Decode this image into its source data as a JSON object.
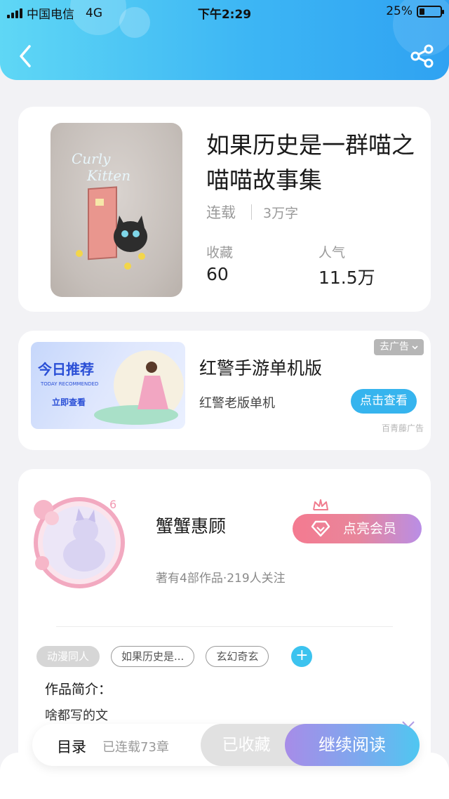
{
  "status_bar": {
    "carrier": "中国电信",
    "network": "4G",
    "time": "下午2:29",
    "battery_text": "25%",
    "battery_level": 0.25
  },
  "header": {
    "back_icon": "chevron-left-icon",
    "share_icon": "share-icon"
  },
  "book": {
    "cover_text_line1": "Curly",
    "cover_text_line2": "Kitten",
    "title": "如果历史是一群喵之喵喵故事集",
    "status": "连载",
    "word_count": "3万字",
    "favorites_label": "收藏",
    "favorites_value": "60",
    "popularity_label": "人气",
    "popularity_value": "11.5万"
  },
  "ad": {
    "image_title": "今日推荐",
    "image_subtitle": "TODAY RECOMMENDED",
    "image_cta": "立即查看",
    "close_label": "去广告",
    "title": "红警手游单机版",
    "subtitle": "红警老版单机",
    "button": "点击查看",
    "source": "百青藤广告"
  },
  "author": {
    "avatar_badge": "6",
    "name": "蟹蟹惠顾",
    "meta": "著有4部作品·219人关注",
    "vip_button": "点亮会员",
    "tags": [
      "动漫同人",
      "如果历史是...",
      "玄幻奇玄"
    ],
    "add_tag": "+",
    "intro_label": "作品简介：",
    "intro_text": "啥都写的文"
  },
  "bottom_bar": {
    "toc_label": "目录",
    "toc_sub": "已连载73章",
    "fav_button": "已收藏",
    "read_button": "继续阅读"
  },
  "colors": {
    "header_start": "#5fd7f5",
    "header_end": "#2fa2f2",
    "accent_blue": "#36b4ee",
    "vip_pink": "#f47a90",
    "read_purple": "#a78ce8"
  }
}
